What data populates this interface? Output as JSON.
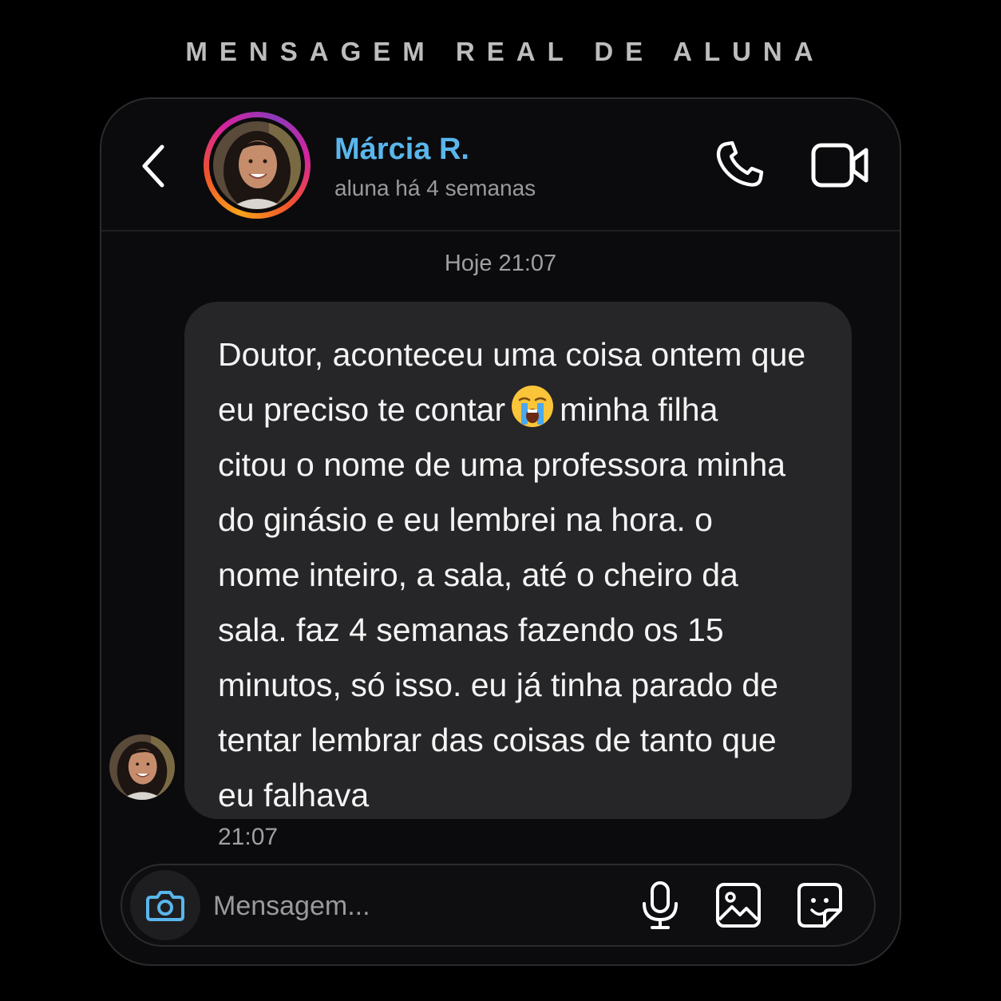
{
  "caption": "MENSAGEM REAL DE ALUNA",
  "header": {
    "contact_name": "Márcia R.",
    "contact_subtitle": "aluna há 4 semanas",
    "icons": {
      "back": "chevron-left-icon",
      "call": "phone-icon",
      "video": "video-camera-icon"
    }
  },
  "conversation": {
    "day_timestamp": "Hoje 21:07",
    "message": {
      "text_before_emoji": "Doutor, aconteceu uma coisa ontem que\neu preciso te contar",
      "emoji": "loudly-crying-face-emoji",
      "text_after_emoji": "minha filha\ncitou o nome de uma professora minha\ndo ginásio e eu lembrei na hora. o\nnome inteiro, a sala, até o cheiro da\nsala. faz 4 semanas fazendo os 15\nminutos, só isso. eu já tinha parado de\ntentar lembrar das coisas de tanto que\neu falhava",
      "time": "21:07"
    }
  },
  "composer": {
    "placeholder": "Mensagem...",
    "icons": {
      "camera": "camera-icon",
      "mic": "microphone-icon",
      "gallery": "image-icon",
      "sticker": "sticker-icon"
    }
  },
  "colors": {
    "background": "#000000",
    "card": "#0b0b0d",
    "bubble": "#262628",
    "accent_name": "#5ab6ec",
    "camera_icon": "#5ab6ec",
    "muted_text": "#9a9a9e"
  }
}
